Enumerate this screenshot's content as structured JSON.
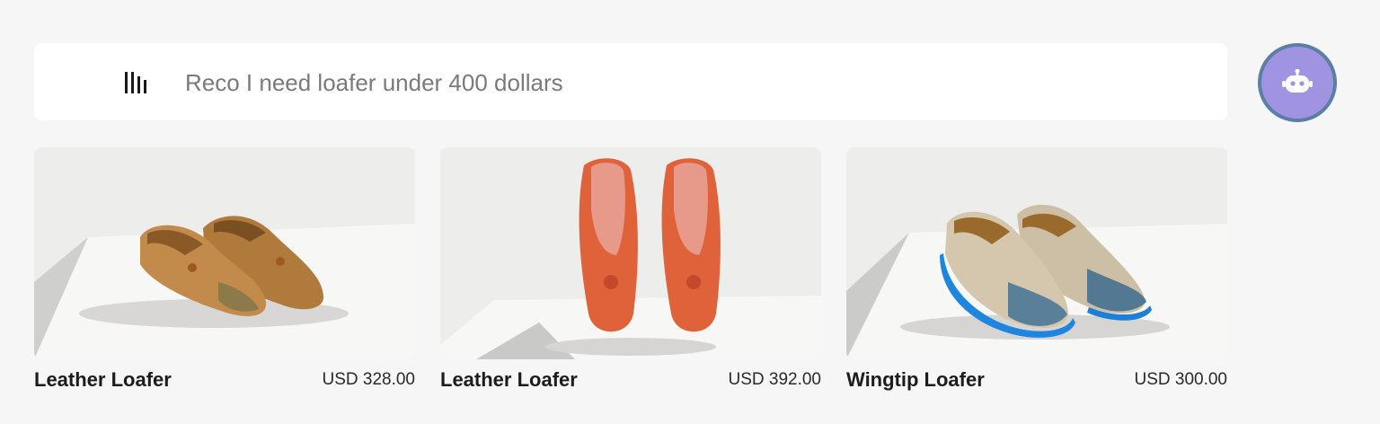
{
  "search": {
    "query": "Reco I need loafer under 400 dollars",
    "filter_icon": "filter-bars-icon"
  },
  "assistant": {
    "icon": "robot-icon",
    "color": "#9f93e2"
  },
  "products": [
    {
      "name": "Leather Loafer",
      "price": "USD 328.00",
      "color": "tan brown"
    },
    {
      "name": "Leather Loafer",
      "price": "USD 392.00",
      "color": "orange"
    },
    {
      "name": "Wingtip Loafer",
      "price": "USD 300.00",
      "color": "beige and blue"
    }
  ]
}
